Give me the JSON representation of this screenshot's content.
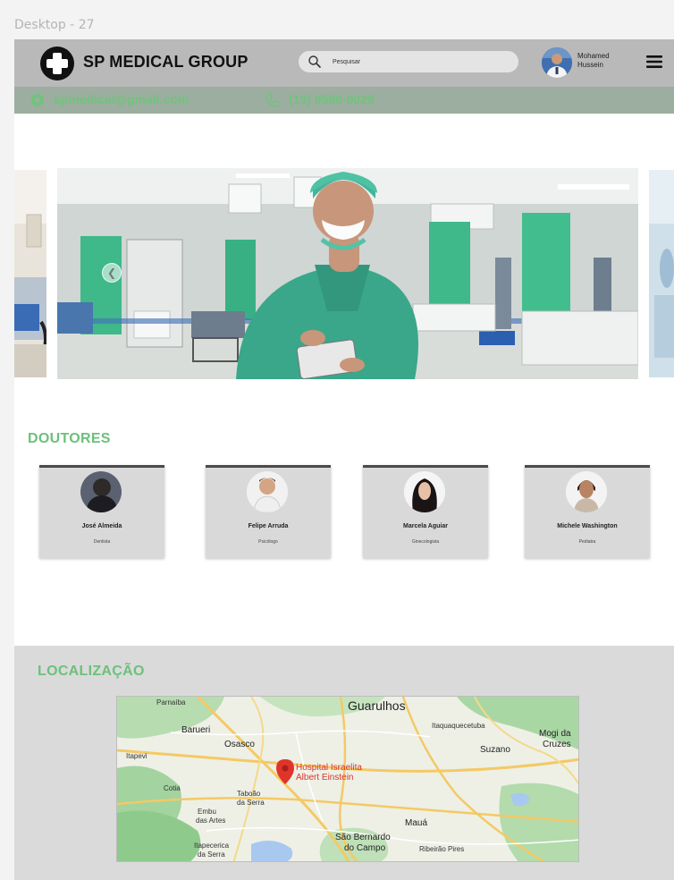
{
  "frame": {
    "label": "Desktop - 27"
  },
  "header": {
    "brand": "SP MEDICAL GROUP",
    "search_placeholder": "Pesquisar",
    "user": {
      "first": "Mohamed",
      "last": "Hussein"
    }
  },
  "contact": {
    "email": "spmedical@gmail.com",
    "phone": "(19) 9580-0029"
  },
  "doctors": {
    "title": "DOUTORES",
    "items": [
      {
        "name": "José Almeida",
        "role": "Dentista"
      },
      {
        "name": "Felipe Arruda",
        "role": "Psicólogo"
      },
      {
        "name": "Marcela Aguiar",
        "role": "Ginecologista"
      },
      {
        "name": "Michele Washington",
        "role": "Pediatra"
      }
    ]
  },
  "location": {
    "title": "LOCALIZAÇÃO",
    "map": {
      "pin_label_1": "Hospital Israelita",
      "pin_label_2": "Albert Einstein",
      "places": {
        "guarulhos": "Guarulhos",
        "barueri": "Barueri",
        "osasco": "Osasco",
        "itapevi": "Itapevi",
        "cotia": "Cotia",
        "taboao_1": "Taboão",
        "taboao_2": "da Serra",
        "embu_1": "Embu",
        "embu_2": "das Artes",
        "maua": "Mauá",
        "sbc_1": "São Bernardo",
        "sbc_2": "do Campo",
        "suzano": "Suzano",
        "mogi_1": "Mogi da",
        "mogi_2": "Cruzes",
        "itaquaquecetuba": "Itaquaquecetuba",
        "ribeirao_pires": "Ribeirão Pires",
        "parnaiba": "Parnaíba",
        "itapecerica_1": "Itapecerica",
        "itapecerica_2": "da Serra"
      }
    }
  }
}
